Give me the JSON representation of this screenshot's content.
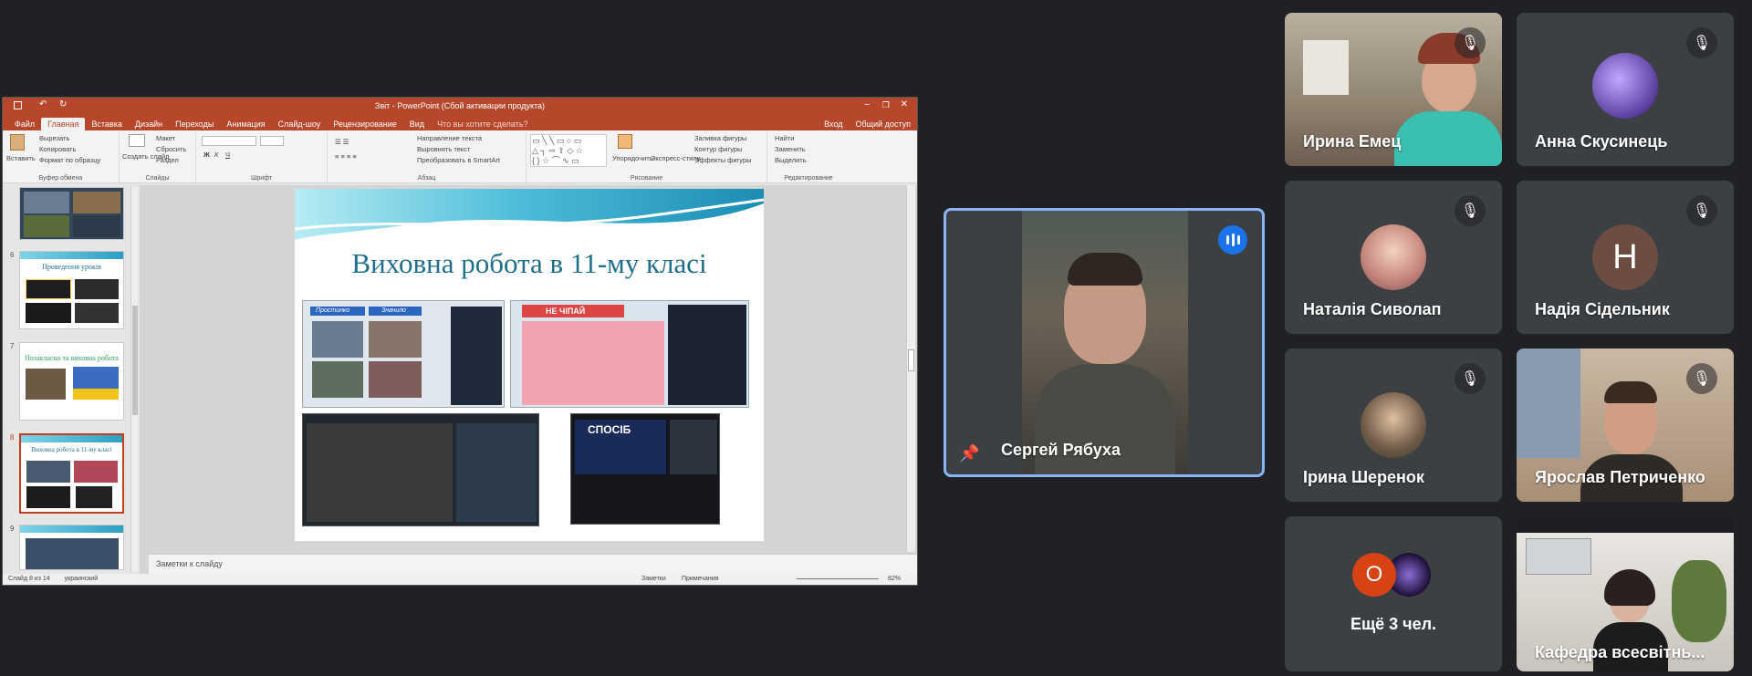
{
  "ppt": {
    "window_title": "Звіт - PowerPoint (Сбой активации продукта)",
    "signin": "Вход",
    "share": "Общий доступ",
    "menu": [
      "Файл",
      "Главная",
      "Вставка",
      "Дизайн",
      "Переходы",
      "Анимация",
      "Слайд-шоу",
      "Рецензирование",
      "Вид"
    ],
    "tell_me": "Что вы хотите сделать?",
    "ribbon": {
      "paste": "Вставить",
      "cut": "Вырезать",
      "copy": "Копировать",
      "format_painter": "Формат по образцу",
      "clipboard": "Буфер обмена",
      "new_slide": "Создать слайд",
      "layout": "Макет",
      "reset": "Сбросить",
      "section": "Раздел",
      "slides": "Слайды",
      "font": "Шрифт",
      "text_direction": "Направление текста",
      "align_text": "Выровнять текст",
      "smartart": "Преобразовать в SmartArt",
      "paragraph": "Абзац",
      "arrange": "Упорядочить",
      "quick_styles": "Экспресс-стили",
      "shape_fill": "Заливка фигуры",
      "shape_outline": "Контур фигуры",
      "shape_effects": "Эффекты фигуры",
      "drawing": "Рисование",
      "find": "Найти",
      "replace": "Заменить",
      "select": "Выделить",
      "editing": "Редактирование"
    },
    "thumbnails": [
      {
        "num": "6",
        "title": "Проведення уроків"
      },
      {
        "num": "7",
        "title": "Позакласна та виховна робота"
      },
      {
        "num": "8",
        "title": "Виховна робота в 11-му класі"
      },
      {
        "num": "9",
        "title": ""
      }
    ],
    "slide_title": "Виховна робота в 11-му класі",
    "slide_sign_1": "Простинко",
    "slide_sign_2": "Значило",
    "slide_sign_3": "НЕ ЧІПАЙ",
    "slide_sign_4": "СПОСІБ",
    "notes_placeholder": "Заметки к слайду",
    "status_slide": "Слайд 8 из 14",
    "status_lang": "украинский",
    "status_notes": "Заметки",
    "status_comments": "Примечания",
    "zoom": "82%"
  },
  "meet": {
    "speaker": {
      "name": "Сергей Рябуха"
    },
    "participants": [
      {
        "name": "Ирина Емец"
      },
      {
        "name": "Анна Скусинець"
      },
      {
        "name": "Наталія Сиволап"
      },
      {
        "name": "Надія Сідельник",
        "initial": "Н"
      },
      {
        "name": "Ірина Шеренок"
      },
      {
        "name": "Ярослав Петриченко"
      },
      {
        "name": "Ещё 3 чел.",
        "initial": "O"
      },
      {
        "name": "Кафедра всесвітнь..."
      }
    ],
    "colors": {
      "background": "#202124",
      "tile": "#3c4043",
      "speaking_border": "#8ab4f8",
      "speaking_badge": "#1a73e8",
      "avatar_brown": "#6d4c41",
      "avatar_red": "#d84315"
    }
  }
}
